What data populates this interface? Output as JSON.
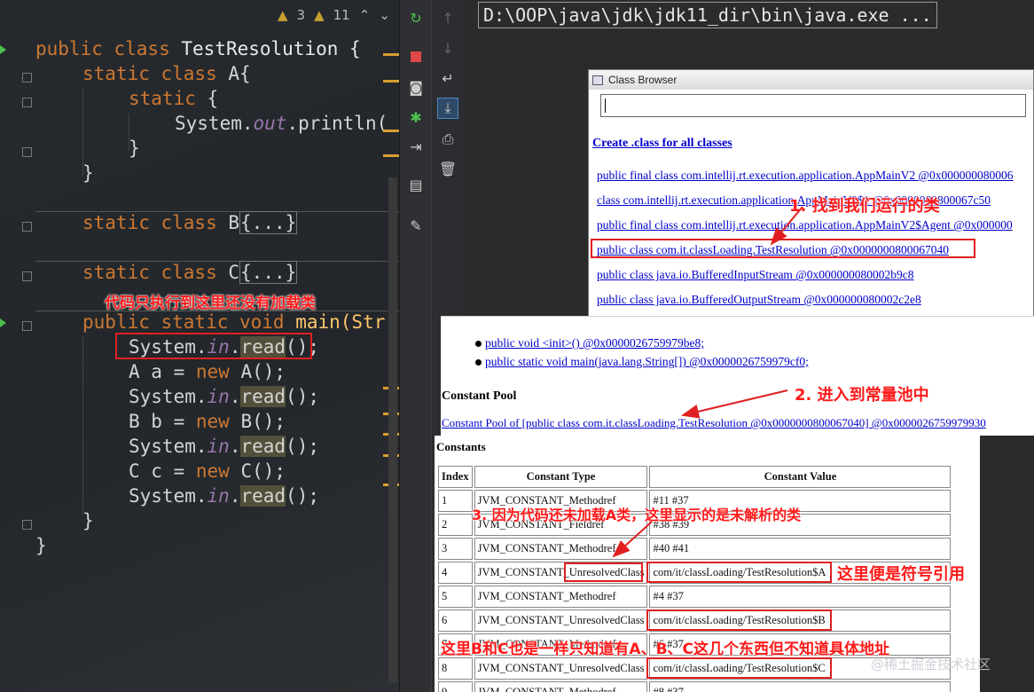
{
  "editor": {
    "inspection": {
      "warnings": "3",
      "weak_warnings": "11"
    },
    "lines": {
      "l1": {
        "kw": "public class ",
        "name": "TestResolution {"
      },
      "l2": {
        "kw": "static class ",
        "name": "A{"
      },
      "l3": {
        "kw": "static ",
        "rest": "{"
      },
      "l4": {
        "a": "System.",
        "b": "out",
        "c": ".println("
      },
      "l5": "}",
      "l6": "}",
      "l7": {
        "kw": "static class ",
        "name": "B",
        "folded": "{...}"
      },
      "l8": {
        "kw": "static class ",
        "name": "C",
        "folded": "{...}"
      },
      "l9": {
        "kw": "public static void ",
        "name": "main(Str"
      },
      "l10": {
        "a": "System.",
        "b": "in",
        "c": ".",
        "d": "read",
        "e": "();"
      },
      "l11": {
        "a": "A ",
        "v": "a",
        "b": " = ",
        "kw": "new ",
        "c": "A();"
      },
      "l12": {
        "a": "System.",
        "b": "in",
        "c": ".",
        "d": "read",
        "e": "();"
      },
      "l13": {
        "a": "B ",
        "v": "b",
        "b": " = ",
        "kw": "new ",
        "c": "B();"
      },
      "l14": {
        "a": "System.",
        "b": "in",
        "c": ".",
        "d": "read",
        "e": "();"
      },
      "l15": {
        "a": "C ",
        "v": "c",
        "b": " = ",
        "kw": "new ",
        "c": "C();"
      },
      "l16": {
        "a": "System.",
        "b": "in",
        "c": ".",
        "d": "read",
        "e": "();"
      },
      "l17": "}",
      "l18": "}"
    }
  },
  "console": {
    "command": "D:\\OOP\\java\\jdk\\jdk11_dir\\bin\\java.exe ..."
  },
  "class_browser": {
    "title": "Class Browser",
    "create_link": "Create .class for all classes",
    "classes": [
      "public final class com.intellij.rt.execution.application.AppMainV2 @0x000000080006",
      "class com.intellij.rt.execution.application.AppMainV2$1 @0x0000000800067c50",
      "public final class com.intellij.rt.execution.application.AppMainV2$Agent @0x000000",
      "public class com.it.classLoading.TestResolution @0x0000000800067040",
      "public class java.io.BufferedInputStream @0x000000080002b9c8",
      "public class java.io.BufferedOutputStream @0x000000080002c2e8"
    ]
  },
  "class_detail": {
    "methods": [
      "public void <init>() @0x0000026759979be8;",
      "public static void main(java.lang.String[]) @0x0000026759979cf0;"
    ],
    "constant_pool_heading": "Constant Pool",
    "constant_pool_link": "Constant Pool of [public class com.it.classLoading.TestResolution @0x0000000800067040] @0x0000026759979930",
    "constants_heading": "Constants",
    "table": {
      "headers": [
        "Index",
        "Constant Type",
        "Constant Value"
      ],
      "rows": [
        [
          "1",
          "JVM_CONSTANT_Methodref",
          "#11 #37"
        ],
        [
          "2",
          "JVM_CONSTANT_Fieldref",
          "#38 #39"
        ],
        [
          "3",
          "JVM_CONSTANT_Methodref",
          "#40 #41"
        ],
        [
          "4",
          "JVM_CONSTANT_UnresolvedClass",
          "com/it/classLoading/TestResolution$A"
        ],
        [
          "5",
          "JVM_CONSTANT_Methodref",
          "#4 #37"
        ],
        [
          "6",
          "JVM_CONSTANT_UnresolvedClass",
          "com/it/classLoading/TestResolution$B"
        ],
        [
          "7",
          "JVM_CONSTANT_Methodref",
          "#6 #37"
        ],
        [
          "8",
          "JVM_CONSTANT_UnresolvedClass",
          "com/it/classLoading/TestResolution$C"
        ],
        [
          "9",
          "JVM_CONSTANT_Methodref",
          "#8 #37"
        ]
      ]
    }
  },
  "annotations": {
    "code_note": "代码只执行到这里还没有加载类",
    "step1": "1. 找到我们运行的类",
    "step2": "2. 进入到常量池中",
    "step3": "3. 因为代码还未加载A类，这里显示的是未解析的类",
    "symbolic_ref": "这里便是符号引用",
    "bc_note": "这里B和C也是一样只知道有A、B、C这几个东西但不知道具体地址"
  },
  "watermark": "@稀土掘金技术社区",
  "colors": {
    "keyword": "#cc7832",
    "static_field": "#9876aa",
    "annotation_red": "#ff1a1a",
    "link": "#0000cc"
  }
}
